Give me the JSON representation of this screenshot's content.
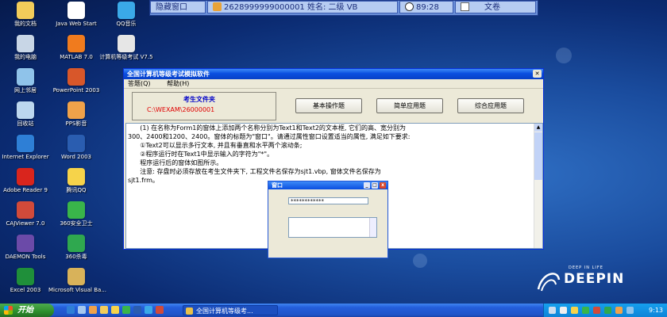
{
  "desktop": {
    "icons": [
      {
        "id": "my-documents",
        "label": "我的文档",
        "color": "#f2cc5a"
      },
      {
        "id": "java-web-start",
        "label": "Java Web Start",
        "color": "#ffffff"
      },
      {
        "id": "qq-music",
        "label": "QQ音乐",
        "color": "#3aa9e8"
      },
      {
        "id": "my-computer",
        "label": "我的电脑",
        "color": "#c8d6e6"
      },
      {
        "id": "matlab",
        "label": "MATLAB 7.0",
        "color": "#f07b1e"
      },
      {
        "id": "exam-sim",
        "label": "计算机等级考试 V7.5",
        "color": "#e6e6e6"
      },
      {
        "id": "network",
        "label": "网上邻居",
        "color": "#8fc3ea"
      },
      {
        "id": "powerpoint",
        "label": "PowerPoint 2003",
        "color": "#d8572a"
      },
      {
        "id": "recycle-bin",
        "label": "回收站",
        "color": "#bcd7ef"
      },
      {
        "id": "pps",
        "label": "PPS影音",
        "color": "#f0a24a"
      },
      {
        "id": "ie",
        "label": "Internet Explorer",
        "color": "#2e7fd6"
      },
      {
        "id": "word",
        "label": "Word 2003",
        "color": "#2a5db0"
      },
      {
        "id": "adobe-reader",
        "label": "Adobe Reader 9",
        "color": "#d9251d"
      },
      {
        "id": "qq",
        "label": "腾讯QQ",
        "color": "#f6d34a"
      },
      {
        "id": "cajviewer",
        "label": "CAJViewer 7.0",
        "color": "#d14a3a"
      },
      {
        "id": "360-safe",
        "label": "360安全卫士",
        "color": "#39b54a"
      },
      {
        "id": "daemon-tools",
        "label": "DAEMON Tools",
        "color": "#6b4aa8"
      },
      {
        "id": "360-antivirus",
        "label": "360杀毒",
        "color": "#2fa84f"
      },
      {
        "id": "excel",
        "label": "Excel 2003",
        "color": "#1f8f3a"
      },
      {
        "id": "vb",
        "label": "Microsoft Visual Ba...",
        "color": "#d8b25a"
      }
    ]
  },
  "exambar": {
    "hide_window": "隐藏窗口",
    "candidate": "2628999999000001  姓名: 二级 VB",
    "timer": "89:28",
    "paper": "文卷"
  },
  "window": {
    "title": "全国计算机等级考试模拟软件",
    "menu": [
      "答题(Q)",
      "帮助(H)"
    ],
    "folder_label": "考生文件夹",
    "folder_path": "C:\\WEXAM\\26000001",
    "buttons": [
      "基本操作题",
      "简单应用题",
      "综合应用题"
    ],
    "question": [
      "      (1) 在名称为Form1的窗体上添加两个名称分别为Text1和Text2的文本框, 它们的高、宽分别为",
      "300、2400和1200、2400。窗体的标题为\"窗口\"。请通过属性窗口设置适当的属性, 满足如下要求:",
      "      ①Text2可以显示多行文本, 并且有垂直和水平两个滚动条;",
      "      ②程序运行时在Text1中显示输入的字符为\"*\"。",
      "      程序运行后的窗体如图所示。",
      "      注意: 存盘时必须存放在考生文件夹下, 工程文件名保存为sjt1.vbp, 窗体文件名保存为",
      "sjt1.frm。"
    ]
  },
  "demo": {
    "title": "窗口",
    "password": "************"
  },
  "brand": {
    "small": "DEEP IN LIFE",
    "big": "DEEPIN"
  },
  "taskbar": {
    "start": "开始",
    "task": "全国计算机等级考...",
    "clock": "9:13"
  }
}
